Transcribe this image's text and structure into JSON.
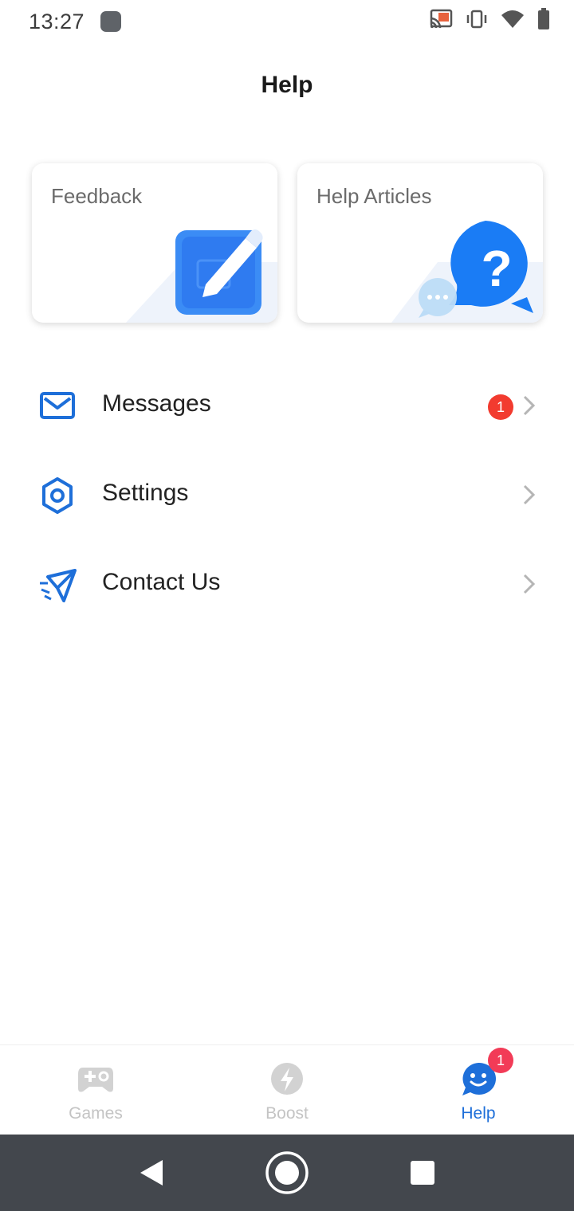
{
  "status_bar": {
    "time": "13:27"
  },
  "header": {
    "title": "Help"
  },
  "cards": [
    {
      "label": "Feedback",
      "icon": "edit-icon"
    },
    {
      "label": "Help Articles",
      "icon": "question-chat-icon"
    }
  ],
  "menu": {
    "items": [
      {
        "label": "Messages",
        "icon": "mail-icon",
        "badge": "1"
      },
      {
        "label": "Settings",
        "icon": "gear-icon"
      },
      {
        "label": "Contact Us",
        "icon": "paper-plane-icon"
      }
    ]
  },
  "bottom_nav": {
    "items": [
      {
        "label": "Games",
        "icon": "gamepad-icon",
        "active": false
      },
      {
        "label": "Boost",
        "icon": "lightning-icon",
        "active": false
      },
      {
        "label": "Help",
        "icon": "smiley-chat-icon",
        "active": true,
        "badge": "1"
      }
    ]
  },
  "colors": {
    "accent": "#1e6fd9",
    "badge_red": "#f23b2f",
    "inactive": "#c4c4c4"
  }
}
